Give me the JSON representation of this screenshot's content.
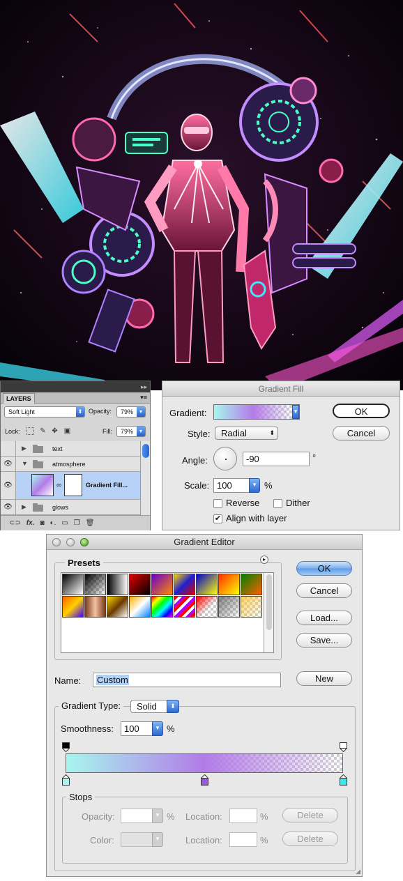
{
  "layers_panel": {
    "panel_menu_glyph": "▸▸",
    "tab_label": "LAYERS",
    "menu_glyph": "▾≡",
    "blend_mode": "Soft Light",
    "opacity_label": "Opacity:",
    "opacity_value": "79%",
    "lock_label": "Lock:",
    "fill_label": "Fill:",
    "fill_value": "79%",
    "layers": [
      {
        "name": "text",
        "type": "group",
        "visible": false
      },
      {
        "name": "atmosphere",
        "type": "group",
        "visible": true,
        "expanded": true
      },
      {
        "name": "Gradient Fill...",
        "type": "fill",
        "visible": true,
        "selected": true
      },
      {
        "name": "glows",
        "type": "group",
        "visible": true
      }
    ],
    "bottom_icons": [
      "link-icon",
      "fx-icon",
      "mask-icon",
      "adjustment-icon",
      "new-group-icon",
      "new-layer-icon",
      "trash-icon"
    ],
    "bottom_glyphs": [
      "⊂⊃",
      "fx.",
      "◙",
      "◐.",
      "▭",
      "❐",
      "🗑"
    ]
  },
  "gradient_fill": {
    "title": "Gradient Fill",
    "gradient_label": "Gradient:",
    "style_label": "Style:",
    "style_value": "Radial",
    "angle_label": "Angle:",
    "angle_value": "-90",
    "degree_symbol": "°",
    "scale_label": "Scale:",
    "scale_value": "100",
    "percent_symbol": "%",
    "reverse_label": "Reverse",
    "reverse_checked": false,
    "dither_label": "Dither",
    "dither_checked": false,
    "align_label": "Align with layer",
    "align_checked": true,
    "ok_label": "OK",
    "cancel_label": "Cancel"
  },
  "gradient_editor": {
    "title": "Gradient Editor",
    "presets_label": "Presets",
    "ok_label": "OK",
    "cancel_label": "Cancel",
    "load_label": "Load...",
    "save_label": "Save...",
    "name_label": "Name:",
    "name_value": "Custom",
    "new_label": "New",
    "gradient_type_label": "Gradient Type:",
    "gradient_type_value": "Solid",
    "smoothness_label": "Smoothness:",
    "smoothness_value": "100",
    "smoothness_unit": "%",
    "stops_label": "Stops",
    "opacity_label": "Opacity:",
    "opacity_unit": "%",
    "color_label": "Color:",
    "location_label": "Location:",
    "location_unit": "%",
    "delete_label": "Delete",
    "gradient_colors": {
      "start": "#a8f6ee",
      "mid": "#b27be8",
      "end": "#ffffff"
    },
    "color_stops": [
      {
        "location": 0,
        "color": "#a8f6ee"
      },
      {
        "location": 50,
        "color": "#9a58e0"
      },
      {
        "location": 100,
        "color": "#3ee7f0"
      }
    ],
    "opacity_stops": [
      {
        "location": 0,
        "opacity": 100
      },
      {
        "location": 100,
        "opacity": 0
      }
    ],
    "presets_row1": [
      "linear-gradient(135deg,#000,#fff)",
      "checker-bw",
      "linear-gradient(90deg,#000,#fff)",
      "linear-gradient(135deg,#e00000,#000)",
      "linear-gradient(135deg,#6a00c8,#ff8a00)",
      "linear-gradient(135deg,#ffd700,#2020d0,#e00000)",
      "linear-gradient(135deg,#0000d0,#ffff00)",
      "linear-gradient(135deg,#ff3000,#ffff00)",
      "linear-gradient(135deg,#008000,#ff6000)"
    ],
    "presets_row2": [
      "linear-gradient(135deg,#ff6000,#ffd000,#4000ff)",
      "linear-gradient(90deg,#7a3a1e,#f3c3a2,#7a3a1e)",
      "linear-gradient(135deg,#ffd700,#6a3a00,#fff)",
      "linear-gradient(135deg,#ffb000,#fff,#0080ff)",
      "linear-gradient(135deg,#ff0000,#ffff00,#00ff00,#00ffff,#0000ff,#ff00ff)",
      "repeating-linear-gradient(135deg,#ff0000 0 4px,#fff 4px 8px,#aa00ff 8px 12px)",
      "checker-red",
      "checker-grey",
      "checker-gold"
    ]
  }
}
